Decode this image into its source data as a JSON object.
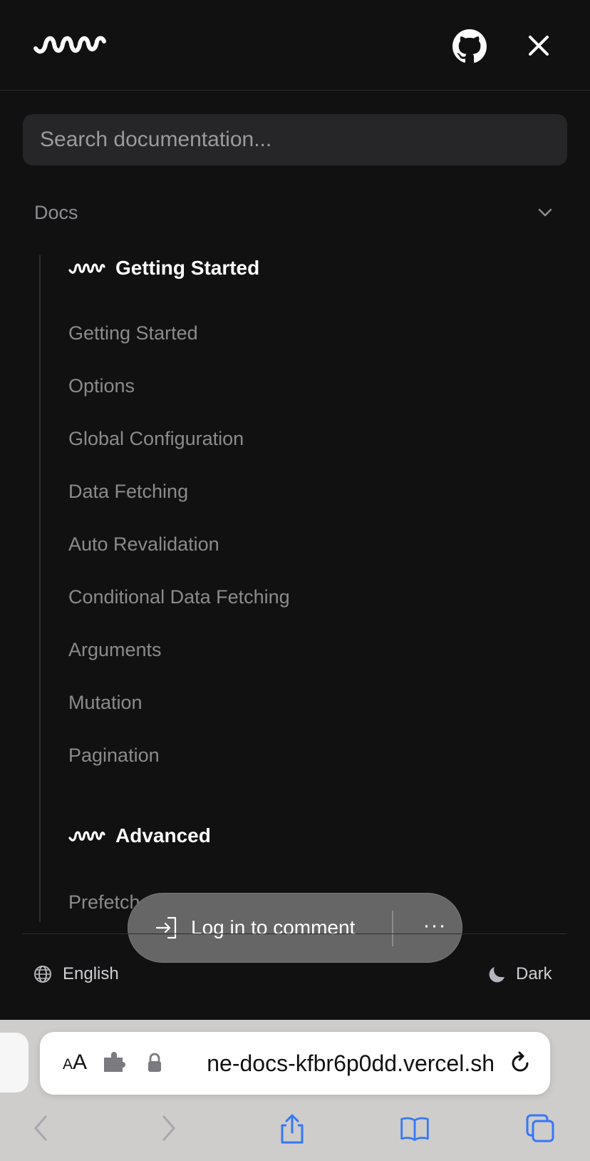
{
  "search": {
    "placeholder": "Search documentation..."
  },
  "sidebar": {
    "section_label": "Docs",
    "categories": [
      {
        "title": "Getting Started",
        "items": [
          "Getting Started",
          "Options",
          "Global Configuration",
          "Data Fetching",
          "Auto Revalidation",
          "Conditional Data Fetching",
          "Arguments",
          "Mutation",
          "Pagination"
        ]
      },
      {
        "title": "Advanced",
        "items": [
          "Prefetch"
        ]
      }
    ]
  },
  "toast": {
    "login_label": "Log in to comment",
    "more_label": "···"
  },
  "footer": {
    "language_label": "English",
    "theme_label": "Dark"
  },
  "browser": {
    "aa_small": "A",
    "aa_large": "A",
    "url": "ne-docs-kfbr6p0dd.vercel.sh"
  },
  "colors": {
    "background": "#111111",
    "search_bg": "#262628",
    "toast_bg": "#666666",
    "ios_blue": "#3478f6"
  },
  "icons": [
    "swr-logo-icon",
    "github-icon",
    "close-icon",
    "chevron-down-icon",
    "login-icon",
    "globe-icon",
    "moon-icon",
    "extension-icon",
    "lock-icon",
    "reload-icon",
    "back-icon",
    "forward-icon",
    "share-icon",
    "bookmarks-icon",
    "tabs-icon"
  ]
}
